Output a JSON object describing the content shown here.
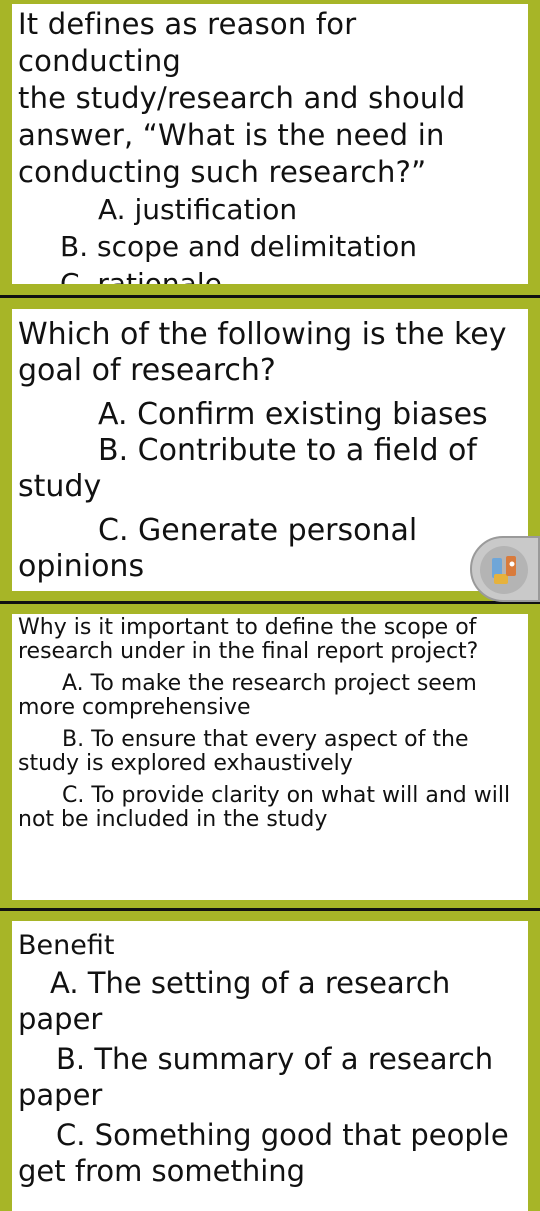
{
  "cards": [
    {
      "question_lines": [
        "It defines as reason for conducting",
        "the study/research and should",
        "answer, “What is the need in",
        "conducting such research?”"
      ],
      "options": [
        "A. justification",
        "B. scope and delimitation",
        "C. rationale"
      ]
    },
    {
      "question_lines": [
        "Which of the following is the key",
        "goal of research?"
      ],
      "options": [
        "A. Confirm existing biases",
        "B. Contribute to a field of study",
        "C. Generate personal opinions"
      ]
    },
    {
      "question_lines": [
        "Why is it important to define the scope of",
        "research under in the final report project?"
      ],
      "options": [
        "A. To make the research project seem more comprehensive",
        "B. To ensure that every aspect of the study is explored exhaustively",
        "C. To provide clarity on what will and will not be included in the study"
      ]
    },
    {
      "question_lines": [
        "Benefit"
      ],
      "options": [
        "A. The setting of a research paper",
        "B. The summary of a research paper",
        "C. Something good that people get from something"
      ]
    }
  ],
  "colors": {
    "background_green": "#a7b527",
    "panel_white": "#ffffff",
    "divider": "#111111",
    "text": "#111111"
  },
  "assistant_icon": "assistant-bubble-icon"
}
